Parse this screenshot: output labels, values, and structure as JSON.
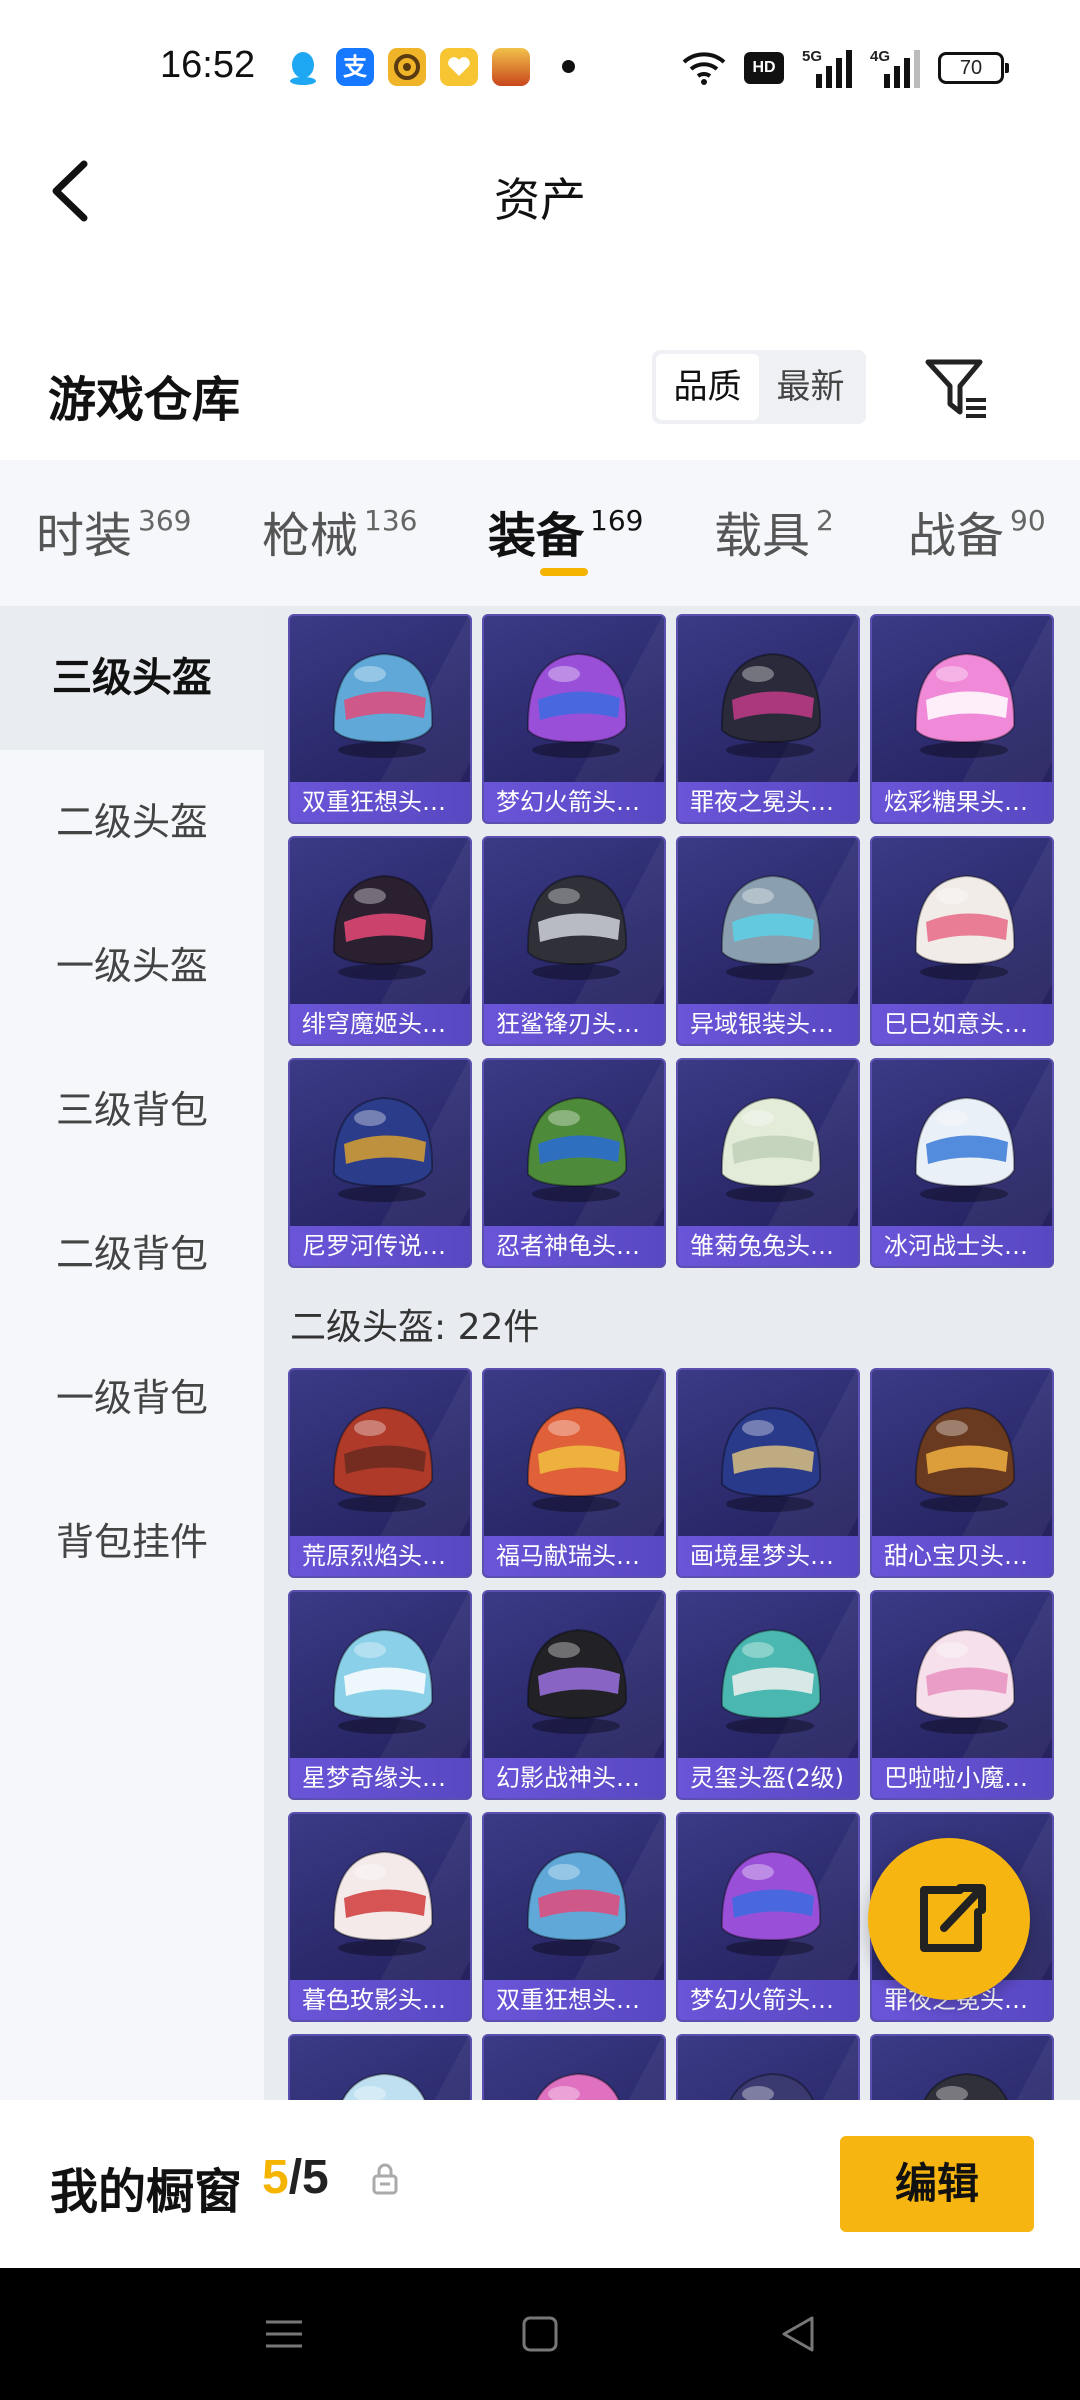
{
  "status_bar": {
    "time": "16:52",
    "apps": [
      {
        "icon": "qq-icon",
        "color": "#1ea7f2",
        "glyph": ""
      },
      {
        "icon": "alipay-icon",
        "color": "#1677ff",
        "glyph": "支"
      },
      {
        "icon": "coin-app-icon",
        "color": "#f0b429",
        "glyph": ""
      },
      {
        "icon": "heart-app-icon",
        "color": "#f7c531",
        "glyph": ""
      },
      {
        "icon": "game-app-icon",
        "color": "#c8461d",
        "glyph": ""
      }
    ],
    "hd": "HD",
    "sig1": "5G",
    "sig2": "4G",
    "battery": "70"
  },
  "header": {
    "title": "资产"
  },
  "warehouse": {
    "title": "游戏仓库",
    "sort_options": [
      "品质",
      "最新"
    ],
    "sort_active": 0
  },
  "tabs": [
    {
      "label": "时装",
      "count": "369"
    },
    {
      "label": "枪械",
      "count": "136"
    },
    {
      "label": "装备",
      "count": "169"
    },
    {
      "label": "载具",
      "count": "2"
    },
    {
      "label": "战备",
      "count": "90"
    }
  ],
  "active_tab": 2,
  "sidebar": {
    "items": [
      "三级头盔",
      "二级头盔",
      "一级头盔",
      "三级背包",
      "二级背包",
      "一级背包",
      "背包挂件"
    ],
    "active": 0
  },
  "section_level3": {
    "items": [
      {
        "name": "双重狂想头盔...",
        "color": "#5fa8d8",
        "accent": "#e24a7a"
      },
      {
        "name": "梦幻火箭头盔...",
        "color": "#9a4fd8",
        "accent": "#3b6ce0"
      },
      {
        "name": "罪夜之冕头盔...",
        "color": "#2a2a3a",
        "accent": "#c23a8a"
      },
      {
        "name": "炫彩糖果头盔...",
        "color": "#f08ad8",
        "accent": "#ffffff"
      },
      {
        "name": "绯穹魔姬头盔...",
        "color": "#2b2030",
        "accent": "#e84a78"
      },
      {
        "name": "狂鲨锋刃头盔...",
        "color": "#2f3038",
        "accent": "#d0d4da"
      },
      {
        "name": "异域银装头盔...",
        "color": "#8aa0b0",
        "accent": "#5ad0e8"
      },
      {
        "name": "巳巳如意头盔...",
        "color": "#f2ece8",
        "accent": "#e86a86"
      },
      {
        "name": "尼罗河传说头...",
        "color": "#2b3c8a",
        "accent": "#d8a030"
      },
      {
        "name": "忍者神龟头盔...",
        "color": "#4d8a3a",
        "accent": "#2a6ad8"
      },
      {
        "name": "雏菊兔兔头盔...",
        "color": "#e2ecd8",
        "accent": "#c0d0b8"
      },
      {
        "name": "冰河战士头盔...",
        "color": "#eaf0f8",
        "accent": "#3a7ad8"
      }
    ]
  },
  "section_level2": {
    "title": "二级头盔: 22件",
    "items": [
      {
        "name": "荒原烈焰头盔...",
        "color": "#b03a2a",
        "accent": "#6a2a20"
      },
      {
        "name": "福马献瑞头盔...",
        "color": "#e0603a",
        "accent": "#f0c040"
      },
      {
        "name": "画境星梦头盔...",
        "color": "#2a3a8a",
        "accent": "#d8c080"
      },
      {
        "name": "甜心宝贝头盔...",
        "color": "#6a3a20",
        "accent": "#f0b040"
      },
      {
        "name": "星梦奇缘头盔...",
        "color": "#8ad0e8",
        "accent": "#ffffff"
      },
      {
        "name": "幻影战神头盔...",
        "color": "#222226",
        "accent": "#9a70e0"
      },
      {
        "name": "灵玺头盔(2级)",
        "color": "#4ab8b0",
        "accent": "#f0f0f0"
      },
      {
        "name": "巴啦啦小魔仙...",
        "color": "#f6e0ec",
        "accent": "#e890c0"
      },
      {
        "name": "暮色玫影头盔...",
        "color": "#f4eaea",
        "accent": "#d03a3a"
      },
      {
        "name": "双重狂想头盔...",
        "color": "#5fa8d8",
        "accent": "#e24a7a"
      },
      {
        "name": "梦幻火箭头盔...",
        "color": "#9a4fd8",
        "accent": "#3b6ce0"
      },
      {
        "name": "罪夜之冕头盔...",
        "color": "#2a2a3a",
        "accent": "#c23a8a"
      },
      {
        "name": "",
        "color": "#bfe0f0",
        "accent": "#ffffff"
      },
      {
        "name": "",
        "color": "#e070c0",
        "accent": "#8050c0"
      },
      {
        "name": "",
        "color": "#3a3a70",
        "accent": "#a0a0d0"
      },
      {
        "name": "",
        "color": "#30303a",
        "accent": "#c0c0c8"
      }
    ]
  },
  "showcase": {
    "title": "我的橱窗",
    "current": "5",
    "separator": "/",
    "total": "5",
    "edit_label": "编辑"
  },
  "colors": {
    "accent": "#f6b511",
    "tile_bg": "#2b2a6c",
    "tile_label": "#6a55d8"
  }
}
